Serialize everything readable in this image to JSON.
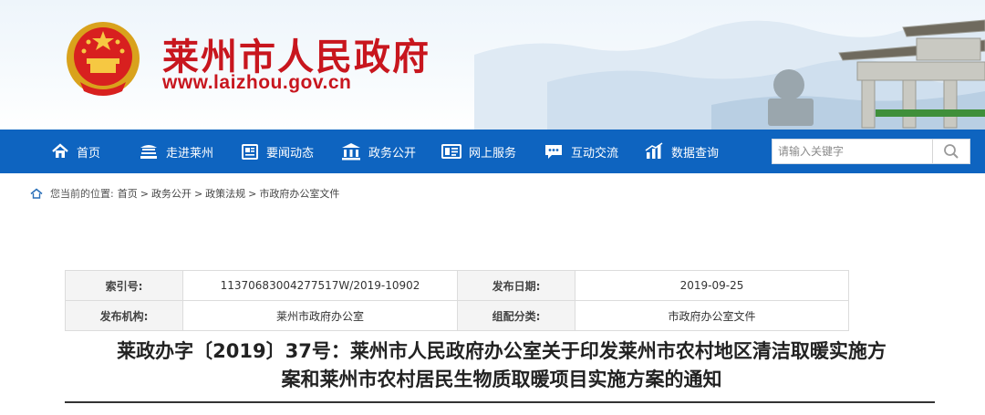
{
  "header": {
    "site_name": "莱州市人民政府",
    "site_url": "www.laizhou.gov.cn"
  },
  "nav": {
    "items": [
      {
        "label": "首页",
        "icon": "home-icon"
      },
      {
        "label": "走进莱州",
        "icon": "landmark-icon"
      },
      {
        "label": "要闻动态",
        "icon": "newspaper-icon"
      },
      {
        "label": "政务公开",
        "icon": "government-building-icon"
      },
      {
        "label": "网上服务",
        "icon": "online-service-icon"
      },
      {
        "label": "互动交流",
        "icon": "chat-bubble-icon"
      },
      {
        "label": "数据查询",
        "icon": "bar-chart-icon"
      }
    ],
    "search_placeholder": "请输入关键字"
  },
  "breadcrumb": {
    "prefix": "您当前的位置:",
    "items": [
      "首页",
      "政务公开",
      "政策法规",
      "市政府办公室文件"
    ],
    "separator": ">"
  },
  "info": {
    "index_label": "索引号:",
    "index_value": "11370683004277517W/2019-10902",
    "date_label": "发布日期:",
    "date_value": "2019-09-25",
    "org_label": "发布机构:",
    "org_value": "莱州市政府办公室",
    "category_label": "组配分类:",
    "category_value": "市政府办公室文件"
  },
  "document": {
    "title_line1": "莱政办字〔2019〕37号：莱州市人民政府办公室关于印发莱州市农村地区清洁取暖实施方",
    "title_line2": "案和莱州市农村居民生物质取暖项目实施方案的通知"
  },
  "colors": {
    "nav_blue": "#0e64c0",
    "brand_red": "#c8161e"
  }
}
